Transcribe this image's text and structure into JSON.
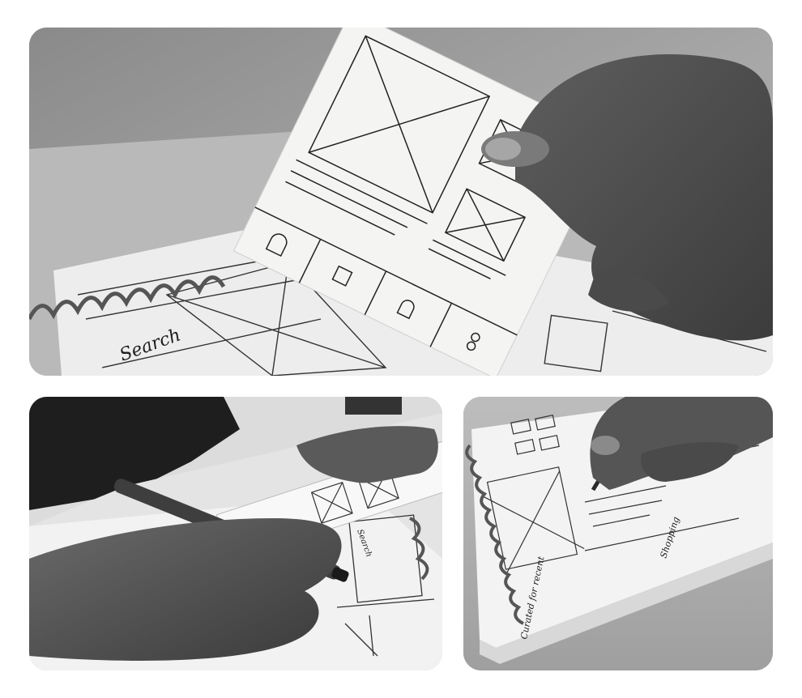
{
  "collage": {
    "style": "grayscale",
    "photo_top": {
      "subject": "hand holding a paper-prototype mobile screen over a spiral sketchbook",
      "sketch_search_label": "Search"
    },
    "photo_bottom_left": {
      "subject": "person sketching a paper-strip wireframe with a marker",
      "sketch_search_label": "Search"
    },
    "photo_bottom_right": {
      "subject": "hand writing notes beside wireframes in a spiral sketchbook",
      "handwritten_notes": [
        "Curated for recent",
        "Shopping"
      ]
    }
  }
}
